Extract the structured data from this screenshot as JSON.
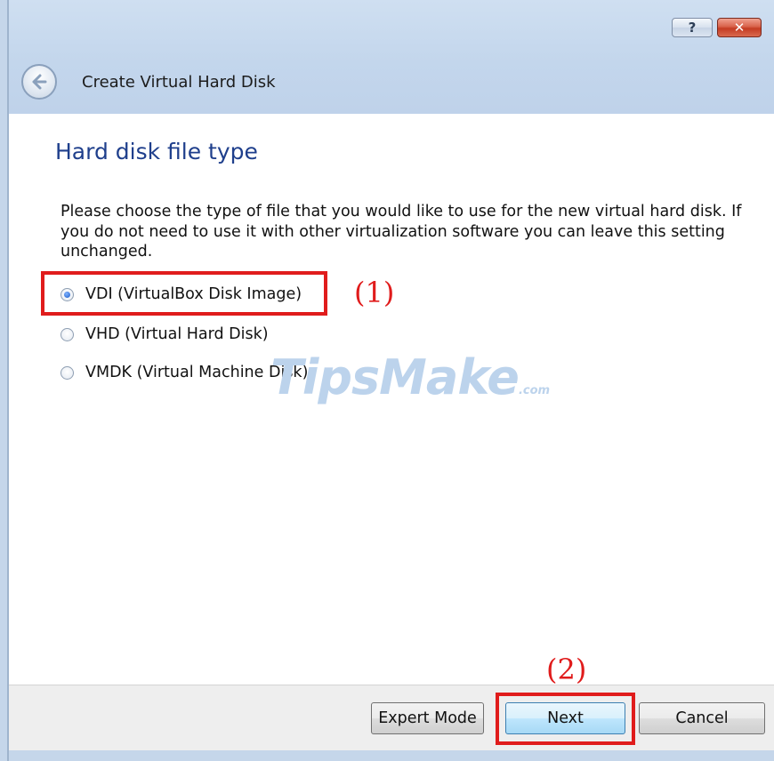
{
  "window": {
    "title": "Create Virtual Hard Disk",
    "help_label": "?",
    "close_label": "✕"
  },
  "page": {
    "heading": "Hard disk file type",
    "description": "Please choose the type of file that you would like to use for the new virtual hard disk. If you do not need to use it with other virtualization software you can leave this setting unchanged."
  },
  "options": [
    {
      "label": "VDI (VirtualBox Disk Image)",
      "selected": true
    },
    {
      "label": "VHD (Virtual Hard Disk)",
      "selected": false
    },
    {
      "label": "VMDK (Virtual Machine Disk)",
      "selected": false
    }
  ],
  "annotations": {
    "step1": "(1)",
    "step2": "(2)"
  },
  "watermark": {
    "text": "TipsMake",
    "suffix": ".com"
  },
  "buttons": {
    "expert": "Expert Mode",
    "next": "Next",
    "cancel": "Cancel"
  },
  "colors": {
    "heading": "#1f3f8c",
    "annotation": "#e01c1c",
    "frame": "#c5d6ea"
  }
}
